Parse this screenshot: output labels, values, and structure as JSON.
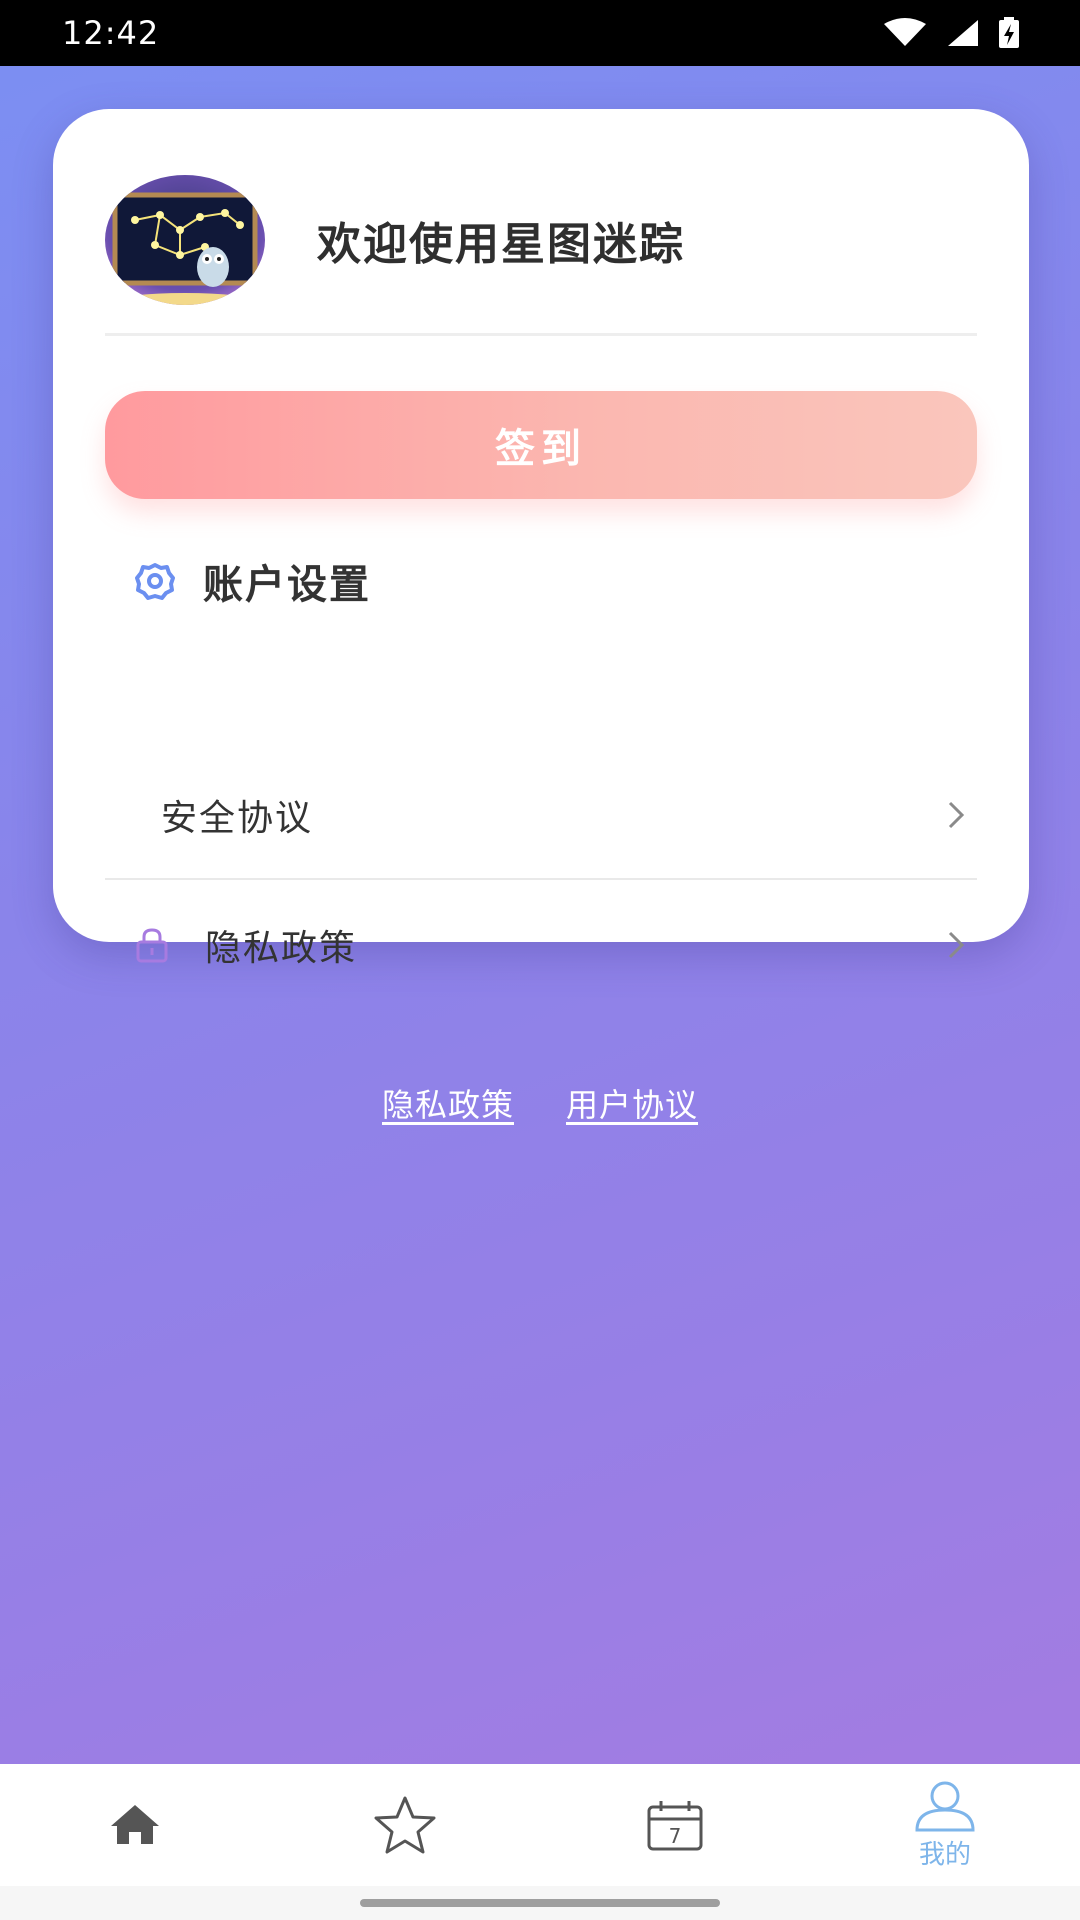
{
  "status_bar": {
    "time": "12:42"
  },
  "profile": {
    "welcome_text": "欢迎使用星图迷踪"
  },
  "checkin": {
    "label": "签到"
  },
  "account_settings": {
    "title": "账户设置",
    "items": [
      {
        "label": "安全协议"
      },
      {
        "label": "隐私政策"
      }
    ]
  },
  "links": {
    "privacy": "隐私政策",
    "user_agreement": "用户协议"
  },
  "bottom_nav": {
    "items": [
      {
        "icon": "home-icon"
      },
      {
        "icon": "star-icon"
      },
      {
        "icon": "calendar-icon",
        "day": "7"
      },
      {
        "icon": "user-icon",
        "label": "我的"
      }
    ],
    "active_color": "#7eb5ea"
  },
  "colors": {
    "checkin_gradient": [
      "#ff9a9e",
      "#fac6bc"
    ],
    "settings_icon": "#6b8ff0",
    "lock_icon": "#a77be0"
  }
}
